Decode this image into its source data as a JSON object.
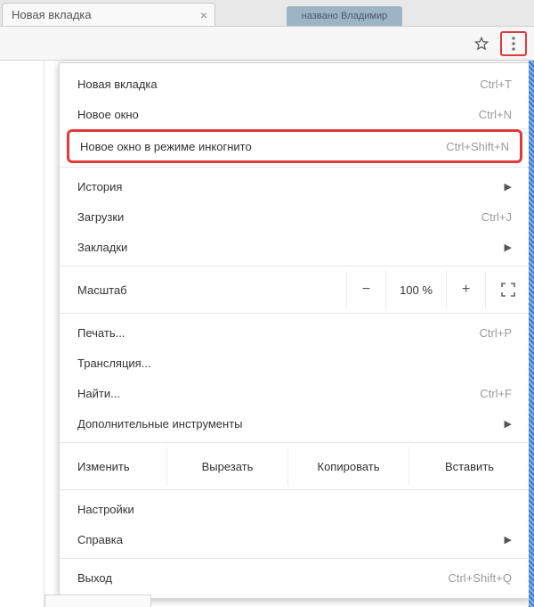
{
  "tab": {
    "title": "Новая вкладка"
  },
  "bgTab": "названо Владимир",
  "menu": {
    "newTab": {
      "label": "Новая вкладка",
      "shortcut": "Ctrl+T"
    },
    "newWindow": {
      "label": "Новое окно",
      "shortcut": "Ctrl+N"
    },
    "incognito": {
      "label": "Новое окно в режиме инкогнито",
      "shortcut": "Ctrl+Shift+N"
    },
    "history": {
      "label": "История"
    },
    "downloads": {
      "label": "Загрузки",
      "shortcut": "Ctrl+J"
    },
    "bookmarks": {
      "label": "Закладки"
    },
    "zoom": {
      "label": "Масштаб",
      "minus": "−",
      "value": "100 %",
      "plus": "+"
    },
    "print": {
      "label": "Печать...",
      "shortcut": "Ctrl+P"
    },
    "cast": {
      "label": "Трансляция..."
    },
    "find": {
      "label": "Найти...",
      "shortcut": "Ctrl+F"
    },
    "moreTools": {
      "label": "Дополнительные инструменты"
    },
    "edit": {
      "label": "Изменить",
      "cut": "Вырезать",
      "copy": "Копировать",
      "paste": "Вставить"
    },
    "settings": {
      "label": "Настройки"
    },
    "help": {
      "label": "Справка"
    },
    "exit": {
      "label": "Выход",
      "shortcut": "Ctrl+Shift+Q"
    }
  }
}
